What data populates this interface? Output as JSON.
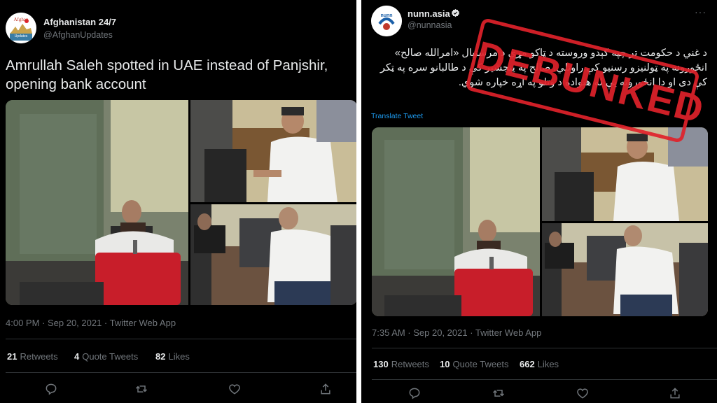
{
  "left_tweet": {
    "display_name": "Afghanistan 24/7",
    "handle": "@AfghanUpdates",
    "avatar_text": "Afghan Updates",
    "text": "Amrullah Saleh spotted in UAE instead of Panjshir, opening bank account",
    "timestamp": "4:00 PM · Sep 20, 2021 · Twitter Web App",
    "stats": {
      "retweets_count": "21",
      "retweets_label": "Retweets",
      "quotes_count": "4",
      "quotes_label": "Quote Tweets",
      "likes_count": "82",
      "likes_label": "Likes"
    }
  },
  "right_tweet": {
    "display_name": "nunn.asia",
    "handle": "@nunnasia",
    "avatar_text": "nunn",
    "text": "د غني د حکومت تر چپه کېدو وروسته د ټاکو مړي د مرستیال «امرالله صالح» انځورونه په ټولنیزو رسنیو کې راوتلي. صالح په پنجشیر کې د طالبانو سره په ټکر کې دی او دا انځورونه یې له هېواده د وتلو په اړه خپاره شوي.",
    "translate_label": "Translate Tweet",
    "timestamp": "7:35 AM · Sep 20, 2021 · Twitter Web App",
    "stats": {
      "retweets_count": "130",
      "retweets_label": "Retweets",
      "quotes_count": "10",
      "quotes_label": "Quote Tweets",
      "likes_count": "662",
      "likes_label": "Likes"
    }
  },
  "stamp_text": "DEBUNKED",
  "colors": {
    "background": "#000000",
    "text": "#e7e9ea",
    "muted": "#71767b",
    "accent": "#1d9bf0",
    "stamp": "#e0222b",
    "verified": "#1d9bf0"
  },
  "icons": [
    "reply-icon",
    "retweet-icon",
    "like-icon",
    "share-icon",
    "verified-icon",
    "more-icon"
  ]
}
